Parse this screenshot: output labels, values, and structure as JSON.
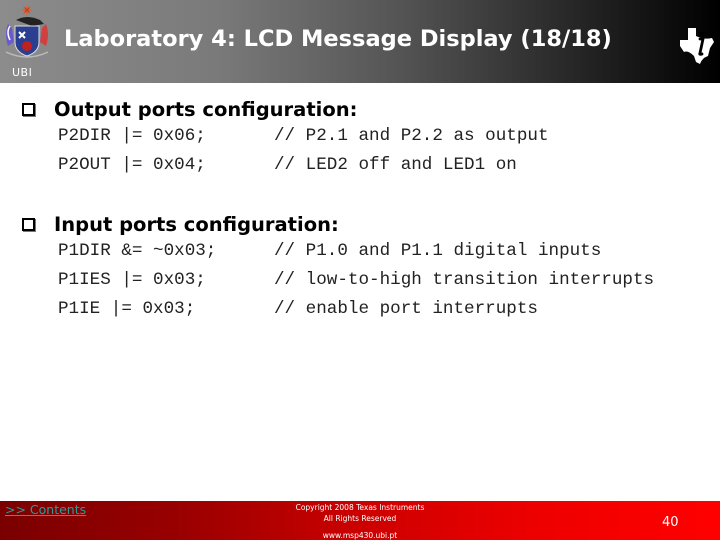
{
  "header": {
    "title": "Laboratory 4: LCD Message Display (18/18)",
    "left_logo": "ubi-coat-of-arms-icon",
    "left_logo_label": "UBI",
    "right_logo": "texas-instruments-logo-icon"
  },
  "sections": [
    {
      "title": "Output ports configuration:",
      "lines": [
        {
          "code": "P2DIR |= 0x06;",
          "comment": "// P2.1 and P2.2 as output"
        },
        {
          "code": "P2OUT |= 0x04;",
          "comment": "// LED2 off and LED1 on"
        }
      ]
    },
    {
      "title": "Input ports configuration:",
      "lines": [
        {
          "code": "P1DIR &= ~0x03;",
          "comment": "// P1.0 and P1.1 digital inputs"
        },
        {
          "code": "P1IES |= 0x03;",
          "comment": "// low-to-high transition interrupts"
        },
        {
          "code": "P1IE |= 0x03;",
          "comment": "// enable port interrupts"
        }
      ]
    }
  ],
  "footer": {
    "contents_link": ">> Contents",
    "copyright_line1": "Copyright  2008 Texas Instruments",
    "copyright_line2": "All Rights Reserved",
    "url": "www.msp430.ubi.pt",
    "page_number": "40"
  },
  "colors": {
    "header_gradient_start": "#8c8c8c",
    "header_gradient_end": "#000000",
    "footer_gradient_start": "#7a0000",
    "footer_gradient_end": "#ff0000",
    "link": "#2e9a9a"
  }
}
